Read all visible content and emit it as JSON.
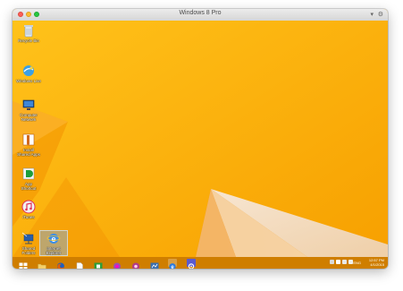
{
  "window": {
    "title": "Windows 8 Pro",
    "icons": {
      "menu": "chevron-down-icon",
      "settings": "gear-icon"
    }
  },
  "desktop": {
    "wallpaper_colors": {
      "base": "#f9a400",
      "light": "#ffd08a",
      "dark": "#e58a00",
      "cream": "#f4dcc0"
    },
    "icons": [
      {
        "name": "recycle-bin-icon",
        "label": "Recycle Bin"
      },
      {
        "name": "windows-live-icon",
        "label": "Windows Live"
      },
      {
        "name": "computer-icon",
        "label": "Computer\nNetwork"
      },
      {
        "name": "app-installer-icon",
        "label": "Install\nShared Apps"
      },
      {
        "name": "app-shortcut-icon",
        "label": "App\nShortcut"
      },
      {
        "name": "itunes-icon",
        "label": "iTunes"
      },
      {
        "name": "network-share-icon",
        "label": "Shared\nFolders"
      },
      {
        "name": "internet-explorer-icon",
        "label": "Internet\nExplorer"
      }
    ]
  },
  "taskbar": {
    "buttons": [
      {
        "name": "start-button",
        "icon": "windows-logo-icon",
        "color": "#ffffff"
      },
      {
        "name": "file-explorer-button",
        "icon": "folder-icon",
        "color": "#f3cf6a"
      },
      {
        "name": "firefox-button",
        "icon": "firefox-icon",
        "color": "#e66000"
      },
      {
        "name": "documents-button",
        "icon": "document-icon",
        "color": "#fbfbfb"
      },
      {
        "name": "store-button",
        "icon": "store-icon",
        "color": "#2e9e3a"
      },
      {
        "name": "app-button-1",
        "icon": "app-icon",
        "color": "#9b4fb0"
      },
      {
        "name": "app-button-2",
        "icon": "app-icon",
        "color": "#b03a8a"
      },
      {
        "name": "app-button-3",
        "icon": "app-icon",
        "color": "#3a6fb0"
      },
      {
        "name": "internet-explorer-button",
        "icon": "internet-explorer-icon",
        "color": "#2b7be0"
      },
      {
        "name": "settings-button",
        "icon": "gear-icon",
        "color": "#5a5ad0"
      }
    ],
    "tray": {
      "language": "ENG",
      "time": "12:57 PM",
      "date": "4/1/2015"
    }
  }
}
